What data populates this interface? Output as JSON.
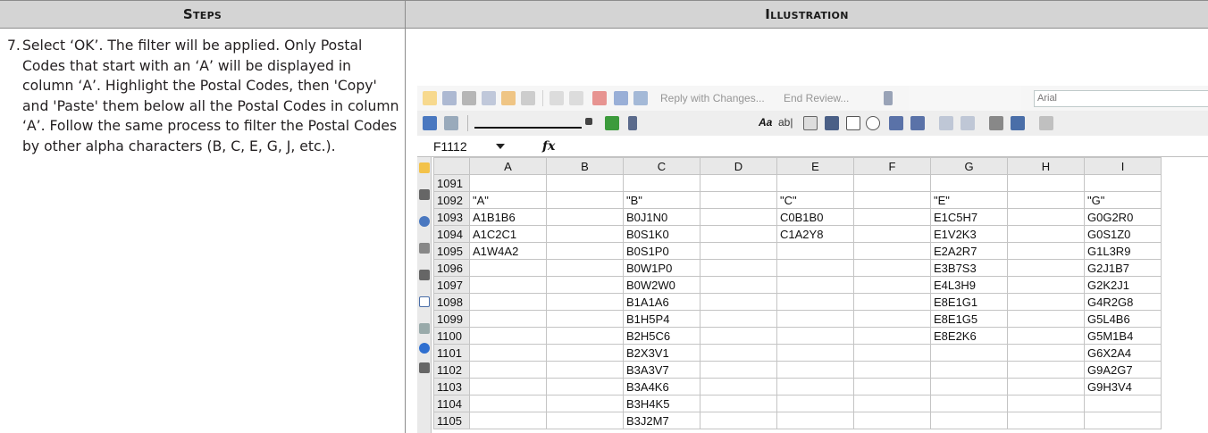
{
  "header": {
    "steps_label": "Steps",
    "illustration_label": "Illustration"
  },
  "step": {
    "number": "7.",
    "text": "Select ‘OK’. The filter will be applied. Only Postal Codes that start with an ‘A’ will be displayed in column ‘A’. Highlight the Postal Codes, then 'Copy' and 'Paste' them below all the Postal Codes in column ‘A’. Follow the same process to filter the Postal Codes by other alpha characters (B, C, E, G, J, etc.)."
  },
  "excel": {
    "toolbar": {
      "reply_text": "Reply with Changes...",
      "end_review_text": "End Review...",
      "font_name": "Arial"
    },
    "name_box": "F1112",
    "fx_label": "fx",
    "columns": [
      "A",
      "B",
      "C",
      "D",
      "E",
      "F",
      "G",
      "H",
      "I"
    ],
    "rows": [
      {
        "num": "1091",
        "cells": [
          "",
          "",
          "",
          "",
          "",
          "",
          "",
          "",
          ""
        ]
      },
      {
        "num": "1092",
        "cells": [
          "\"A\"",
          "",
          "\"B\"",
          "",
          "\"C\"",
          "",
          "\"E\"",
          "",
          "\"G\""
        ]
      },
      {
        "num": "1093",
        "cells": [
          "A1B1B6",
          "",
          "B0J1N0",
          "",
          "C0B1B0",
          "",
          "E1C5H7",
          "",
          "G0G2R0"
        ]
      },
      {
        "num": "1094",
        "cells": [
          "A1C2C1",
          "",
          "B0S1K0",
          "",
          "C1A2Y8",
          "",
          "E1V2K3",
          "",
          "G0S1Z0"
        ]
      },
      {
        "num": "1095",
        "cells": [
          "A1W4A2",
          "",
          "B0S1P0",
          "",
          "",
          "",
          "E2A2R7",
          "",
          "G1L3R9"
        ]
      },
      {
        "num": "1096",
        "cells": [
          "",
          "",
          "B0W1P0",
          "",
          "",
          "",
          "E3B7S3",
          "",
          "G2J1B7"
        ]
      },
      {
        "num": "1097",
        "cells": [
          "",
          "",
          "B0W2W0",
          "",
          "",
          "",
          "E4L3H9",
          "",
          "G2K2J1"
        ]
      },
      {
        "num": "1098",
        "cells": [
          "",
          "",
          "B1A1A6",
          "",
          "",
          "",
          "E8E1G1",
          "",
          "G4R2G8"
        ]
      },
      {
        "num": "1099",
        "cells": [
          "",
          "",
          "B1H5P4",
          "",
          "",
          "",
          "E8E1G5",
          "",
          "G5L4B6"
        ]
      },
      {
        "num": "1100",
        "cells": [
          "",
          "",
          "B2H5C6",
          "",
          "",
          "",
          "E8E2K6",
          "",
          "G5M1B4"
        ]
      },
      {
        "num": "1101",
        "cells": [
          "",
          "",
          "B2X3V1",
          "",
          "",
          "",
          "",
          "",
          "G6X2A4"
        ]
      },
      {
        "num": "1102",
        "cells": [
          "",
          "",
          "B3A3V7",
          "",
          "",
          "",
          "",
          "",
          "G9A2G7"
        ]
      },
      {
        "num": "1103",
        "cells": [
          "",
          "",
          "B3A4K6",
          "",
          "",
          "",
          "",
          "",
          "G9H3V4"
        ]
      },
      {
        "num": "1104",
        "cells": [
          "",
          "",
          "B3H4K5",
          "",
          "",
          "",
          "",
          "",
          ""
        ]
      },
      {
        "num": "1105",
        "cells": [
          "",
          "",
          "B3J2M7",
          "",
          "",
          "",
          "",
          "",
          ""
        ]
      }
    ]
  }
}
